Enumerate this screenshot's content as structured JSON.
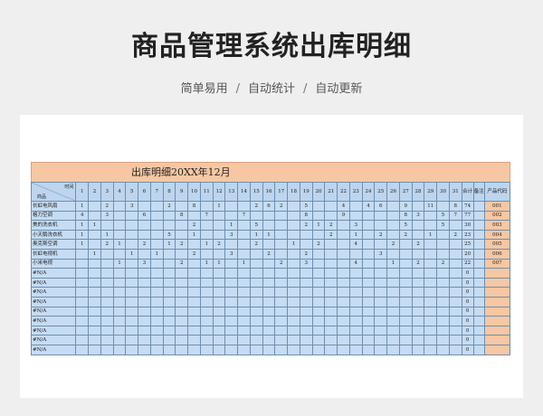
{
  "page": {
    "title": "商品管理系统出库明细",
    "features": [
      "简单易用",
      "自动统计",
      "自动更新"
    ],
    "separator": "/"
  },
  "sheet": {
    "caption": "出库明细20XX年12月",
    "corner_top": "时间",
    "corner_bottom": "商品",
    "days": [
      "1",
      "2",
      "3",
      "4",
      "5",
      "6",
      "7",
      "8",
      "9",
      "10",
      "11",
      "12",
      "13",
      "14",
      "15",
      "16",
      "17",
      "18",
      "19",
      "20",
      "21",
      "22",
      "23",
      "24",
      "25",
      "26",
      "27",
      "28",
      "29",
      "30",
      "31"
    ],
    "total_header": "合计",
    "note_header": "备注",
    "code_header": "产品代码",
    "rows": [
      {
        "name": "长虹电风扇",
        "cells": [
          "1",
          "",
          "2",
          "",
          "3",
          "",
          "",
          "2",
          "",
          "8",
          "",
          "1",
          "",
          "",
          "2",
          "6",
          "2",
          "",
          "5",
          "",
          "",
          "4",
          "",
          "4",
          "6",
          "",
          "9",
          "",
          "11",
          "",
          "8"
        ],
        "total": "74",
        "note": "",
        "code": "001"
      },
      {
        "name": "格力空调",
        "cells": [
          "4",
          "",
          "3",
          "",
          "",
          "6",
          "",
          "",
          "8",
          "",
          "7",
          "",
          "",
          "7",
          "",
          "",
          "",
          "",
          "8",
          "",
          "",
          "9",
          "",
          "",
          "",
          "",
          "8",
          "3",
          "",
          "5",
          "7"
        ],
        "total": "77",
        "note": "",
        "code": "002"
      },
      {
        "name": "美的洗衣机",
        "cells": [
          "1",
          "1",
          "",
          "",
          "",
          "",
          "",
          "",
          "",
          "2",
          "",
          "",
          "1",
          "",
          "5",
          "",
          "",
          "",
          "2",
          "1",
          "2",
          "",
          "3",
          "",
          "",
          "",
          "5",
          "",
          "",
          "5",
          ""
        ],
        "total": "30",
        "note": "",
        "code": "003"
      },
      {
        "name": "小天鹅洗衣机",
        "cells": [
          "1",
          "",
          "1",
          "",
          "",
          "",
          "",
          "5",
          "",
          "1",
          "",
          "",
          "3",
          "",
          "1",
          "1",
          "",
          "",
          "",
          "",
          "2",
          "",
          "1",
          "",
          "2",
          "",
          "2",
          "",
          "1",
          "",
          "2"
        ],
        "total": "23",
        "note": "",
        "code": "004"
      },
      {
        "name": "奥克斯空调",
        "cells": [
          "1",
          "",
          "2",
          "1",
          "",
          "2",
          "",
          "1",
          "2",
          "",
          "1",
          "2",
          "",
          "",
          "2",
          "",
          "",
          "1",
          "",
          "2",
          "",
          "",
          "4",
          "",
          "",
          "2",
          "",
          "2",
          "",
          "",
          ""
        ],
        "total": "25",
        "note": "",
        "code": "005"
      },
      {
        "name": "长虹电视机",
        "cells": [
          "",
          "1",
          "",
          "",
          "1",
          "",
          "1",
          "",
          "",
          "2",
          "",
          "",
          "3",
          "",
          "",
          "2",
          "",
          "",
          "2",
          "",
          "",
          "",
          "",
          "",
          "3",
          "",
          "",
          "",
          "",
          "",
          ""
        ],
        "total": "20",
        "note": "",
        "code": "006"
      },
      {
        "name": "小米电视",
        "cells": [
          "",
          "",
          "",
          "1",
          "",
          "3",
          "",
          "",
          "2",
          "",
          "1",
          "1",
          "",
          "1",
          "",
          "",
          "2",
          "",
          "3",
          "",
          "",
          "",
          "4",
          "",
          "",
          "1",
          "",
          "2",
          "",
          "2",
          ""
        ],
        "total": "22",
        "note": "",
        "code": "007"
      },
      {
        "name": "#N/A",
        "cells": [],
        "total": "0",
        "note": "",
        "code": ""
      },
      {
        "name": "#N/A",
        "cells": [],
        "total": "0",
        "note": "",
        "code": ""
      },
      {
        "name": "#N/A",
        "cells": [],
        "total": "0",
        "note": "",
        "code": ""
      },
      {
        "name": "#N/A",
        "cells": [],
        "total": "0",
        "note": "",
        "code": ""
      },
      {
        "name": "#N/A",
        "cells": [],
        "total": "0",
        "note": "",
        "code": ""
      },
      {
        "name": "#N/A",
        "cells": [],
        "total": "0",
        "note": "",
        "code": ""
      },
      {
        "name": "#N/A",
        "cells": [],
        "total": "0",
        "note": "",
        "code": ""
      },
      {
        "name": "#N/A",
        "cells": [],
        "total": "0",
        "note": "",
        "code": ""
      },
      {
        "name": "#N/A",
        "cells": [],
        "total": "0",
        "note": "",
        "code": ""
      }
    ]
  }
}
